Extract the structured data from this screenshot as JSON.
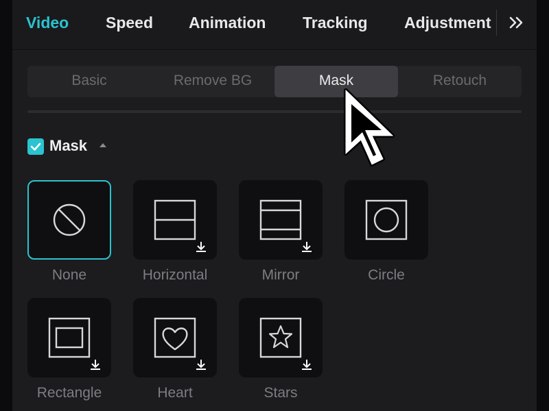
{
  "top_tabs": [
    {
      "label": "Video",
      "active": true
    },
    {
      "label": "Speed",
      "active": false
    },
    {
      "label": "Animation",
      "active": false
    },
    {
      "label": "Tracking",
      "active": false
    },
    {
      "label": "Adjustment",
      "active": false
    }
  ],
  "more_icon": "double-chevron-right-icon",
  "sub_tabs": [
    {
      "label": "Basic",
      "active": false
    },
    {
      "label": "Remove BG",
      "active": false
    },
    {
      "label": "Mask",
      "active": true
    },
    {
      "label": "Retouch",
      "active": false
    }
  ],
  "mask_section": {
    "title": "Mask",
    "checked": true,
    "expanded": true
  },
  "masks": [
    {
      "label": "None",
      "icon": "none-icon",
      "selected": true,
      "downloadable": false
    },
    {
      "label": "Horizontal",
      "icon": "horizontal-mask-icon",
      "selected": false,
      "downloadable": true
    },
    {
      "label": "Mirror",
      "icon": "mirror-mask-icon",
      "selected": false,
      "downloadable": true
    },
    {
      "label": "Circle",
      "icon": "circle-mask-icon",
      "selected": false,
      "downloadable": false
    },
    {
      "label": "Rectangle",
      "icon": "rectangle-mask-icon",
      "selected": false,
      "downloadable": true
    },
    {
      "label": "Heart",
      "icon": "heart-mask-icon",
      "selected": false,
      "downloadable": true
    },
    {
      "label": "Stars",
      "icon": "star-mask-icon",
      "selected": false,
      "downloadable": true
    }
  ],
  "colors": {
    "accent": "#2bc3cf",
    "panel": "#1c1c1f",
    "tile": "#0f0f11"
  }
}
